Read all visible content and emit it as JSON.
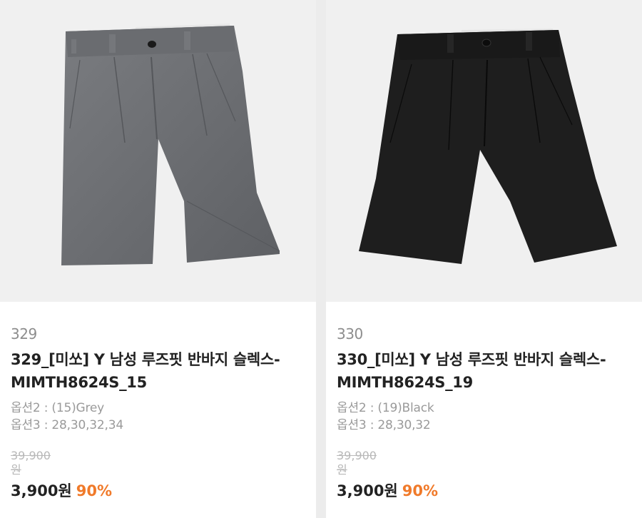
{
  "colors": {
    "accent_discount": "#f07a2a",
    "grey_fabric": "#6d6f72",
    "black_fabric": "#1d1d1d"
  },
  "products": [
    {
      "index": "329",
      "title": "329_[미쏘] Y 남성 루즈핏 반바지 슬렉스-MIMTH8624S_15",
      "option2": "옵션2 : (15)Grey",
      "option3": "옵션3 : 28,30,32,34",
      "original_price": "39,900원",
      "sale_price": "3,900원",
      "discount": "90%",
      "image_icon": "grey-shorts-image"
    },
    {
      "index": "330",
      "title": "330_[미쏘] Y 남성 루즈핏 반바지 슬렉스-MIMTH8624S_19",
      "option2": "옵션2 : (19)Black",
      "option3": "옵션3 : 28,30,32",
      "original_price": "39,900원",
      "sale_price": "3,900원",
      "discount": "90%",
      "image_icon": "black-shorts-image"
    }
  ]
}
